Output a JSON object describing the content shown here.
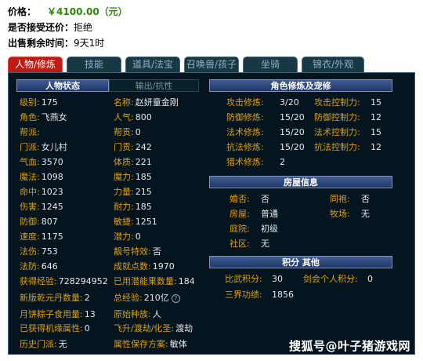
{
  "header": {
    "price_label": "价格：",
    "price_value": "￥4100.00（元）",
    "bargain_label": "是否接受还价：",
    "bargain_value": "拒绝",
    "remaining_label": "出售剩余时间：",
    "remaining_value": "9天1时"
  },
  "tabs": [
    "人物/修炼",
    "技能",
    "道具/法宝",
    "召唤兽/孩子",
    "坐骑",
    "锦衣/外观"
  ],
  "colors": {
    "accent": "#bf1b14",
    "label": "#e0a000",
    "value": "#e8e8e8",
    "panel_bg": "#04151f",
    "header_bg": "#2d4a80",
    "price": "#2a8a00"
  },
  "char": {
    "header": "人物状态",
    "header_alt": "输出/抗性",
    "left": [
      {
        "label": "级别:",
        "value": "175"
      },
      {
        "label": "角色:",
        "value": "飞燕女"
      },
      {
        "label": "帮派:",
        "value": ""
      },
      {
        "label": "门派:",
        "value": "女儿村"
      },
      {
        "label": "气血:",
        "value": "3570"
      },
      {
        "label": "魔法:",
        "value": "1098"
      },
      {
        "label": "命中:",
        "value": "1023"
      },
      {
        "label": "伤害:",
        "value": "1245"
      },
      {
        "label": "防御:",
        "value": "807"
      },
      {
        "label": "速度:",
        "value": "1175"
      },
      {
        "label": "法伤:",
        "value": "753"
      },
      {
        "label": "法防:",
        "value": "646"
      }
    ],
    "right": [
      {
        "label": "名称:",
        "value": "赵妍童金刚"
      },
      {
        "label": "人气:",
        "value": "800"
      },
      {
        "label": "帮贡:",
        "value": "0"
      },
      {
        "label": "门贡:",
        "value": "242"
      },
      {
        "label": "体质:",
        "value": "221"
      },
      {
        "label": "魔力:",
        "value": "185"
      },
      {
        "label": "力量:",
        "value": "215"
      },
      {
        "label": "耐力:",
        "value": "185"
      },
      {
        "label": "敏捷:",
        "value": "1251"
      },
      {
        "label": "潜力:",
        "value": "0"
      },
      {
        "label": "靓号特效:",
        "value": "否"
      },
      {
        "label": "成就点数:",
        "value": "1970"
      }
    ],
    "extra_left": [
      {
        "label": "获得经验:",
        "value": "728294952"
      },
      {
        "label": "新版乾元丹数量:",
        "value": "2"
      },
      {
        "label": "月饼粽子食用量:",
        "value": "13"
      },
      {
        "label": "已获得机缘属性:",
        "value": "0"
      },
      {
        "label": "历史门派:",
        "value": "无"
      }
    ],
    "extra_right": [
      {
        "label": "已用潜能果数量:",
        "value": "184"
      },
      {
        "label": "总经验:",
        "value": "210亿"
      },
      {
        "label": "原始种族:",
        "value": "人"
      },
      {
        "label": "飞升/渡劫/化圣:",
        "value": "渡劫"
      },
      {
        "label": "属性保存方案:",
        "value": "敏体"
      }
    ],
    "help_icon": "?"
  },
  "cultivation": {
    "header": "角色修炼及宠修",
    "left": [
      {
        "label": "攻击修炼:",
        "value": "3/20"
      },
      {
        "label": "防御修炼:",
        "value": "15/20"
      },
      {
        "label": "法术修炼:",
        "value": "15/20"
      },
      {
        "label": "抗法修炼:",
        "value": "15/20"
      },
      {
        "label": "猎术修炼:",
        "value": "2"
      }
    ],
    "right": [
      {
        "label": "攻击控制力:",
        "value": "15"
      },
      {
        "label": "防御控制力:",
        "value": "12"
      },
      {
        "label": "法术控制力:",
        "value": "15"
      },
      {
        "label": "抗法控制力:",
        "value": "12"
      }
    ]
  },
  "house": {
    "header": "房屋信息",
    "left": [
      {
        "label": "婚否:",
        "value": "否"
      },
      {
        "label": "房屋:",
        "value": "普通"
      },
      {
        "label": "庭院:",
        "value": "初级"
      },
      {
        "label": "社区:",
        "value": "无"
      }
    ],
    "right": [
      {
        "label": "同袍:",
        "value": "否"
      },
      {
        "label": "牧场:",
        "value": "无"
      }
    ]
  },
  "points": {
    "header": "积分 其他",
    "rows": [
      {
        "label": "比武积分:",
        "value": "30",
        "label2": "剑会个人积分:",
        "value2": "0"
      },
      {
        "label": "三界功绩:",
        "value": "1856"
      }
    ]
  },
  "watermark": "搜狐号@叶子猪游戏网"
}
